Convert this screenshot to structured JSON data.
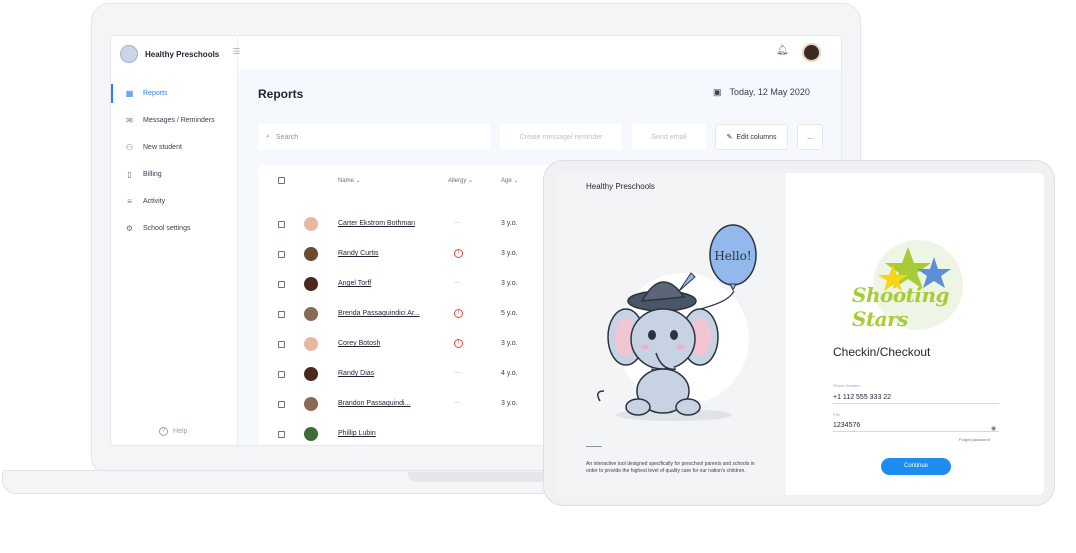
{
  "app": {
    "name": "Healthy Preschools"
  },
  "sidebar": {
    "items": [
      {
        "label": "Reports",
        "icon": "grid-icon",
        "active": true
      },
      {
        "label": "Messages / Reminders",
        "icon": "mail-icon"
      },
      {
        "label": "New student",
        "icon": "add-user-icon"
      },
      {
        "label": "Billing",
        "icon": "bookmark-icon"
      },
      {
        "label": "Activity",
        "icon": "list-icon"
      },
      {
        "label": "School settings",
        "icon": "gear-icon"
      }
    ],
    "help_label": "Help"
  },
  "header": {
    "title": "Reports",
    "date": "Today, 12 May 2020"
  },
  "toolbar": {
    "search_placeholder": "Search",
    "create_label": "Create message/ reminder",
    "send_label": "Send email",
    "edit_columns_label": "Edit columns",
    "more_label": "..."
  },
  "table": {
    "columns": [
      "Name",
      "Allergy",
      "Age"
    ],
    "rows": [
      {
        "name": "Carter Ekstrom Bothman",
        "allergy": "—",
        "age": "3 y.o."
      },
      {
        "name": "Randy Curtis",
        "allergy": "!",
        "age": "3 y.o."
      },
      {
        "name": "Angel Torff",
        "allergy": "—",
        "age": "3 y.o."
      },
      {
        "name": "Brenda Passaquindici Ar...",
        "allergy": "!",
        "age": "5 y.o."
      },
      {
        "name": "Corey Botosh",
        "allergy": "!",
        "age": "3 y.o."
      },
      {
        "name": "Randy Dias",
        "allergy": "—",
        "age": "4 y.o."
      },
      {
        "name": "Brandon Passaquindi...",
        "allergy": "—",
        "age": "3 y.o."
      },
      {
        "name": "Phillip Lubin",
        "allergy": "",
        "age": ""
      }
    ]
  },
  "tablet": {
    "brand": "Healthy Preschools",
    "balloon_text": "Hello!",
    "description": "An interactive tool designed specifically for preschool parents and schools in order to provide the highest level of quality care for our nation's children.",
    "logo_text": "Shooting Stars",
    "heading": "Checkin/Checkout",
    "phone_label": "Phone Number",
    "phone_value": "+1 112 555 333 22",
    "pin_label": "PIN",
    "pin_value": "1234576",
    "forgot_label": "Forgot password?",
    "continue_label": "Continue"
  },
  "colors": {
    "accent": "#2f80ed",
    "alert": "#e04848",
    "button": "#1e8df0",
    "logo_green": "#a7cc35"
  }
}
